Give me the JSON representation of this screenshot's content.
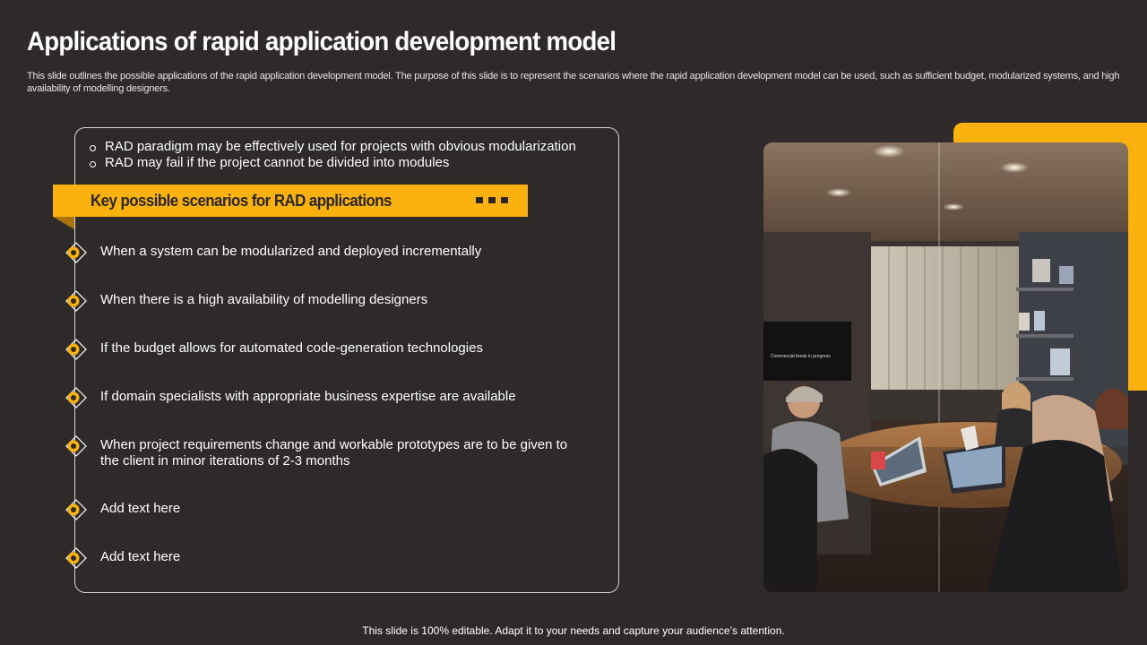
{
  "slide": {
    "title": "Applications of rapid application development model",
    "subtitle": "This slide outlines the possible applications of the rapid application development model. The purpose of this slide is to represent the scenarios where the rapid application development model can be used, such as sufficient budget, modularized systems, and high availability of modelling designers.",
    "footer": "This slide is 100% editable. Adapt it to your needs and capture your audience’s attention."
  },
  "intro_points": [
    "RAD paradigm may be effectively used for projects with obvious modularization",
    "RAD may fail if the project cannot be divided into modules"
  ],
  "banner": {
    "heading": "Key possible scenarios for RAD applications"
  },
  "scenarios": [
    "When a system can be modularized and deployed incrementally",
    "When there is a high availability  of modelling designers",
    "If the budget allows for automated code-generation technologies",
    "If domain specialists with appropriate business expertise are available",
    "When project requirements change and workable prototypes are to be given to the client in minor iterations of 2-3 months",
    "Add text here",
    "Add text here"
  ],
  "photo": {
    "screen_caption": "Commercial break in progress",
    "icon": "meeting-room-photo"
  },
  "colors": {
    "background": "#2f2a2a",
    "accent": "#fbb20f",
    "text": "#ffffff"
  }
}
